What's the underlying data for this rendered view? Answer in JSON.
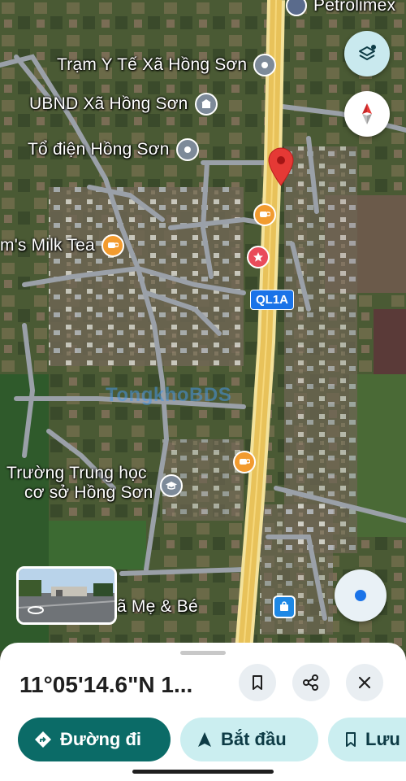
{
  "map": {
    "top_poi": "Petrolimex",
    "route_label": "QL1A",
    "watermark": "TongkhoBDS",
    "pois": [
      {
        "id": "tram-y-te",
        "label": "Trạm Y Tế Xã Hồng Sơn",
        "icon": "hospital-pin"
      },
      {
        "id": "ubnd",
        "label": "UBND Xã Hồng Sơn",
        "icon": "government-building-pin"
      },
      {
        "id": "to-dien",
        "label": "Tổ điện Hồng Sơn",
        "icon": "place-pin"
      },
      {
        "id": "milk-tea",
        "label": "m's Milk Tea",
        "icon": "cafe-cup-pin"
      },
      {
        "id": "truong",
        "label_line1": "Trường Trung học",
        "label_line2": "cơ sở Hồng Sơn",
        "icon": "school-pin"
      },
      {
        "id": "me-be",
        "label": "ã Mẹ & Bé",
        "icon": "shopping-bag-pin"
      }
    ],
    "colors": {
      "highway": "#e8c25a",
      "dropped_pin": "#e53935",
      "location_dot": "#1a73e8"
    }
  },
  "controls": {
    "layers_icon": "layers-icon",
    "compass_icon": "compass-icon",
    "my_location_icon": "my-location-icon",
    "streetview_icon": "street-view-rotate-icon"
  },
  "sheet": {
    "coordinates": "11°05'14.6\"N 1...",
    "save_icon": "bookmark-icon",
    "share_icon": "share-icon",
    "close_icon": "close-icon",
    "actions": {
      "directions": "Đường đi",
      "start": "Bắt đầu",
      "save": "Lưu"
    },
    "accent": "#0b6b67"
  }
}
